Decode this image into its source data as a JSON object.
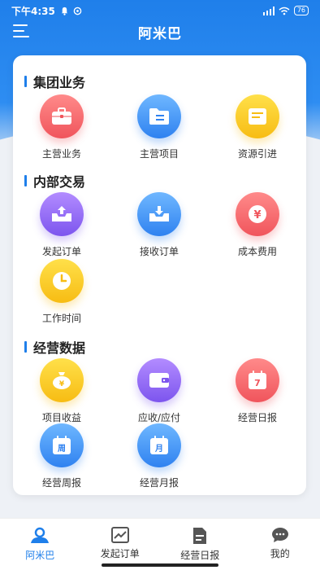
{
  "status_bar": {
    "time": "下午4:35",
    "battery": "76"
  },
  "nav": {
    "title": "阿米巴"
  },
  "sections": [
    {
      "title": "集团业务",
      "items": [
        {
          "label": "主营业务",
          "color": "red",
          "icon": "briefcase-icon"
        },
        {
          "label": "主营项目",
          "color": "blue",
          "icon": "folder-icon"
        },
        {
          "label": "资源引进",
          "color": "yellow",
          "icon": "document-icon"
        }
      ]
    },
    {
      "title": "内部交易",
      "items": [
        {
          "label": "发起订单",
          "color": "purple",
          "icon": "upload-tray-icon"
        },
        {
          "label": "接收订单",
          "color": "blue",
          "icon": "download-tray-icon"
        },
        {
          "label": "成本费用",
          "color": "red",
          "icon": "yen-icon"
        },
        {
          "label": "工作时间",
          "color": "yellow",
          "icon": "clock-icon"
        }
      ]
    },
    {
      "title": "经营数据",
      "items": [
        {
          "label": "项目收益",
          "color": "yellow",
          "icon": "money-bag-icon"
        },
        {
          "label": "应收/应付",
          "color": "purple",
          "icon": "wallet-icon"
        },
        {
          "label": "经营日报",
          "color": "red",
          "icon": "calendar-day-icon",
          "glyph": "7"
        },
        {
          "label": "经营周报",
          "color": "blue",
          "icon": "calendar-week-icon",
          "glyph": "周"
        },
        {
          "label": "经营月报",
          "color": "blue",
          "icon": "calendar-month-icon",
          "glyph": "月"
        }
      ]
    }
  ],
  "tabs": [
    {
      "label": "阿米巴",
      "active": true,
      "icon": "amoeba-icon"
    },
    {
      "label": "发起订单",
      "active": false,
      "icon": "chart-icon"
    },
    {
      "label": "经营日报",
      "active": false,
      "icon": "report-icon"
    },
    {
      "label": "我的",
      "active": false,
      "icon": "chat-icon"
    }
  ]
}
